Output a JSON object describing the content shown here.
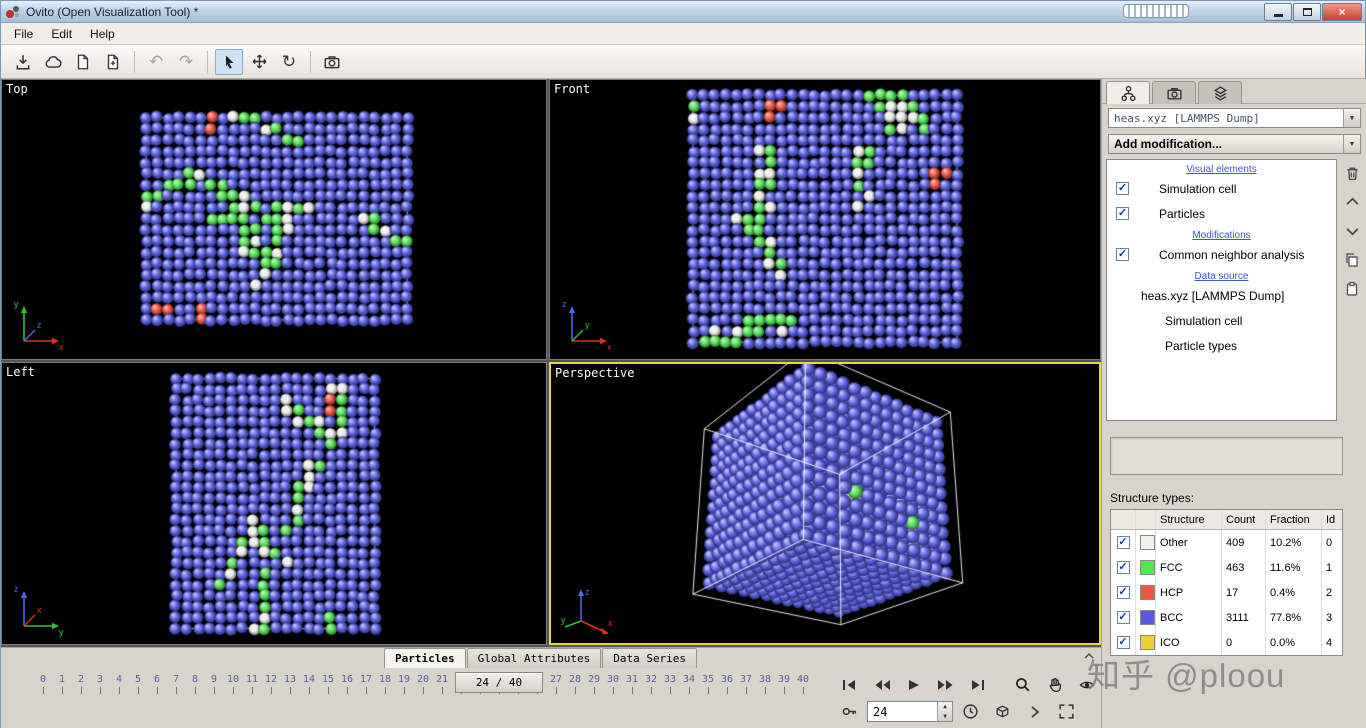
{
  "window": {
    "title": "Ovito (Open Visualization Tool) *"
  },
  "menubar": {
    "items": [
      "File",
      "Edit",
      "Help"
    ]
  },
  "axes": {
    "x": "x",
    "y": "y",
    "z": "z"
  },
  "viewports": {
    "top": {
      "label": "Top"
    },
    "front": {
      "label": "Front"
    },
    "left": {
      "label": "Left"
    },
    "perspective": {
      "label": "Perspective"
    }
  },
  "command_panel": {
    "source_selector": "heas.xyz [LAMMPS Dump]",
    "add_modification_label": "Add modification...",
    "pipeline": [
      {
        "kind": "header",
        "label": "Visual elements"
      },
      {
        "kind": "item",
        "label": "Simulation cell",
        "checked": true
      },
      {
        "kind": "item",
        "label": "Particles",
        "checked": true
      },
      {
        "kind": "header",
        "label": "Modifications"
      },
      {
        "kind": "item",
        "label": "Common neighbor analysis",
        "checked": true
      },
      {
        "kind": "header",
        "label": "Data source"
      },
      {
        "kind": "source",
        "label": "heas.xyz [LAMMPS Dump]",
        "indent": 1
      },
      {
        "kind": "source",
        "label": "Simulation cell",
        "indent": 2
      },
      {
        "kind": "source",
        "label": "Particle types",
        "indent": 2
      }
    ],
    "structure_types": {
      "title": "Structure types:",
      "headers": [
        "Structure",
        "Count",
        "Fraction",
        "Id"
      ],
      "rows": [
        {
          "checked": true,
          "color": "#f2f0ec",
          "structure": "Other",
          "count": "409",
          "fraction": "10.2%",
          "id": "0"
        },
        {
          "checked": true,
          "color": "#53e653",
          "structure": "FCC",
          "count": "463",
          "fraction": "11.6%",
          "id": "1"
        },
        {
          "checked": true,
          "color": "#f25542",
          "structure": "HCP",
          "count": "17",
          "fraction": "0.4%",
          "id": "2"
        },
        {
          "checked": true,
          "color": "#5858e8",
          "structure": "BCC",
          "count": "3111",
          "fraction": "77.8%",
          "id": "3"
        },
        {
          "checked": true,
          "color": "#eecf2e",
          "structure": "ICO",
          "count": "0",
          "fraction": "0.0%",
          "id": "4"
        }
      ]
    }
  },
  "bottom": {
    "tabs": [
      {
        "label": "Particles",
        "active": true
      },
      {
        "label": "Global Attributes",
        "active": false
      },
      {
        "label": "Data Series",
        "active": false
      }
    ],
    "timeline": {
      "start": 0,
      "end": 40,
      "current": 24,
      "current_label": "24 / 40"
    },
    "frame_spinner_value": "24"
  },
  "watermark": "知乎 @ploou",
  "colors": {
    "active_viewport_border": "#e8d44a",
    "particle_bcc": "#5a60dd",
    "particle_fcc": "#55e055",
    "particle_other": "#ecece8",
    "particle_hcp": "#ee5240"
  }
}
